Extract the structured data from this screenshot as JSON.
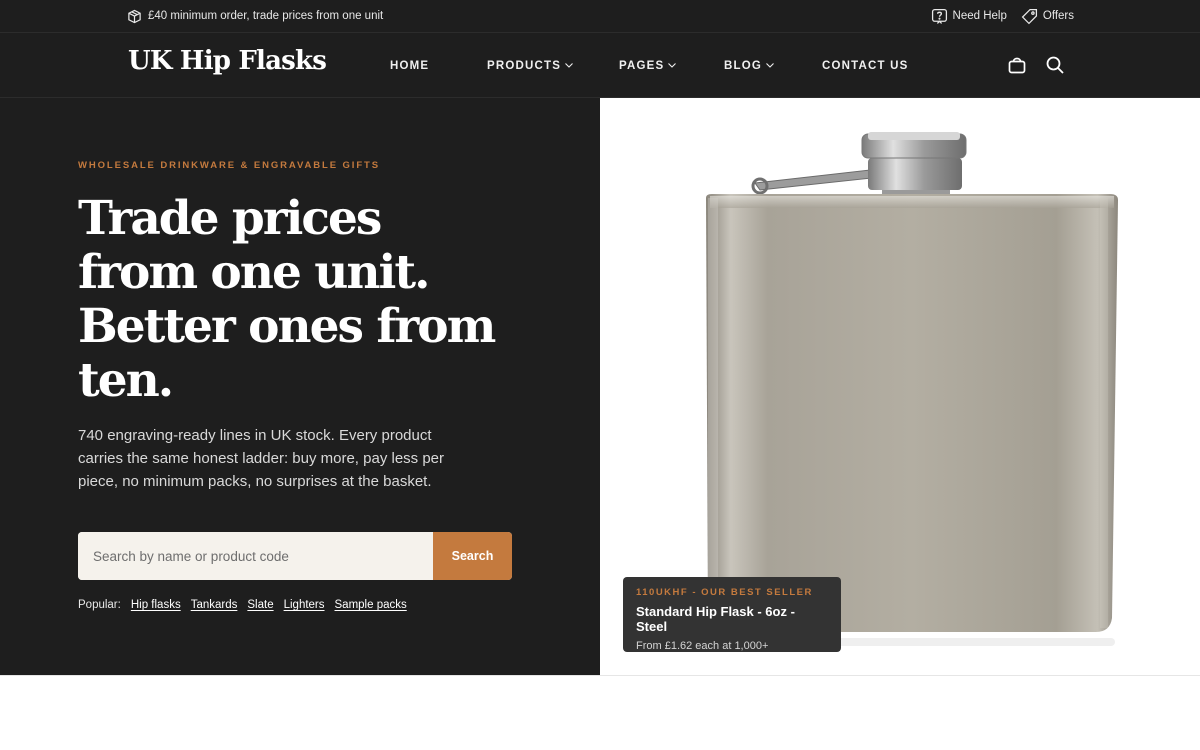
{
  "topbar": {
    "promo_text": "£40 minimum order, trade prices from one unit",
    "need_help_label": "Need Help",
    "offers_label": "Offers"
  },
  "header": {
    "logo_text": "UK Hip Flasks",
    "nav": {
      "home": "HOME",
      "products": "PRODUCTS",
      "pages": "PAGES",
      "blog": "BLOG",
      "contact": "CONTACT US"
    },
    "icons": [
      "basket-icon",
      "search-icon"
    ]
  },
  "hero": {
    "eyebrow": "WHOLESALE DRINKWARE & ENGRAVABLE GIFTS",
    "headline_lines": [
      "Trade prices",
      "from one unit.",
      "Better ones from",
      "ten."
    ],
    "body": "740 engraving-ready lines in UK stock. Every product carries the same honest ladder: buy more, pay less per piece, no minimum packs, no surprises at the basket.",
    "search": {
      "placeholder": "Search by name or product code",
      "button_label": "Search"
    },
    "popular": {
      "label": "Popular:",
      "links": [
        "Hip flasks",
        "Tankards",
        "Slate",
        "Lighters",
        "Sample packs"
      ]
    }
  },
  "featured": {
    "code": "110UKHF - OUR BEST SELLER",
    "name": "Standard Hip Flask - 6oz - Steel",
    "price": "From £1.62 each at 1,000+"
  },
  "colors": {
    "dark_bg": "#1e1e1e",
    "accent": "#c47a3e",
    "search_bg": "#f5f2ec",
    "badge_bg": "#333333"
  }
}
